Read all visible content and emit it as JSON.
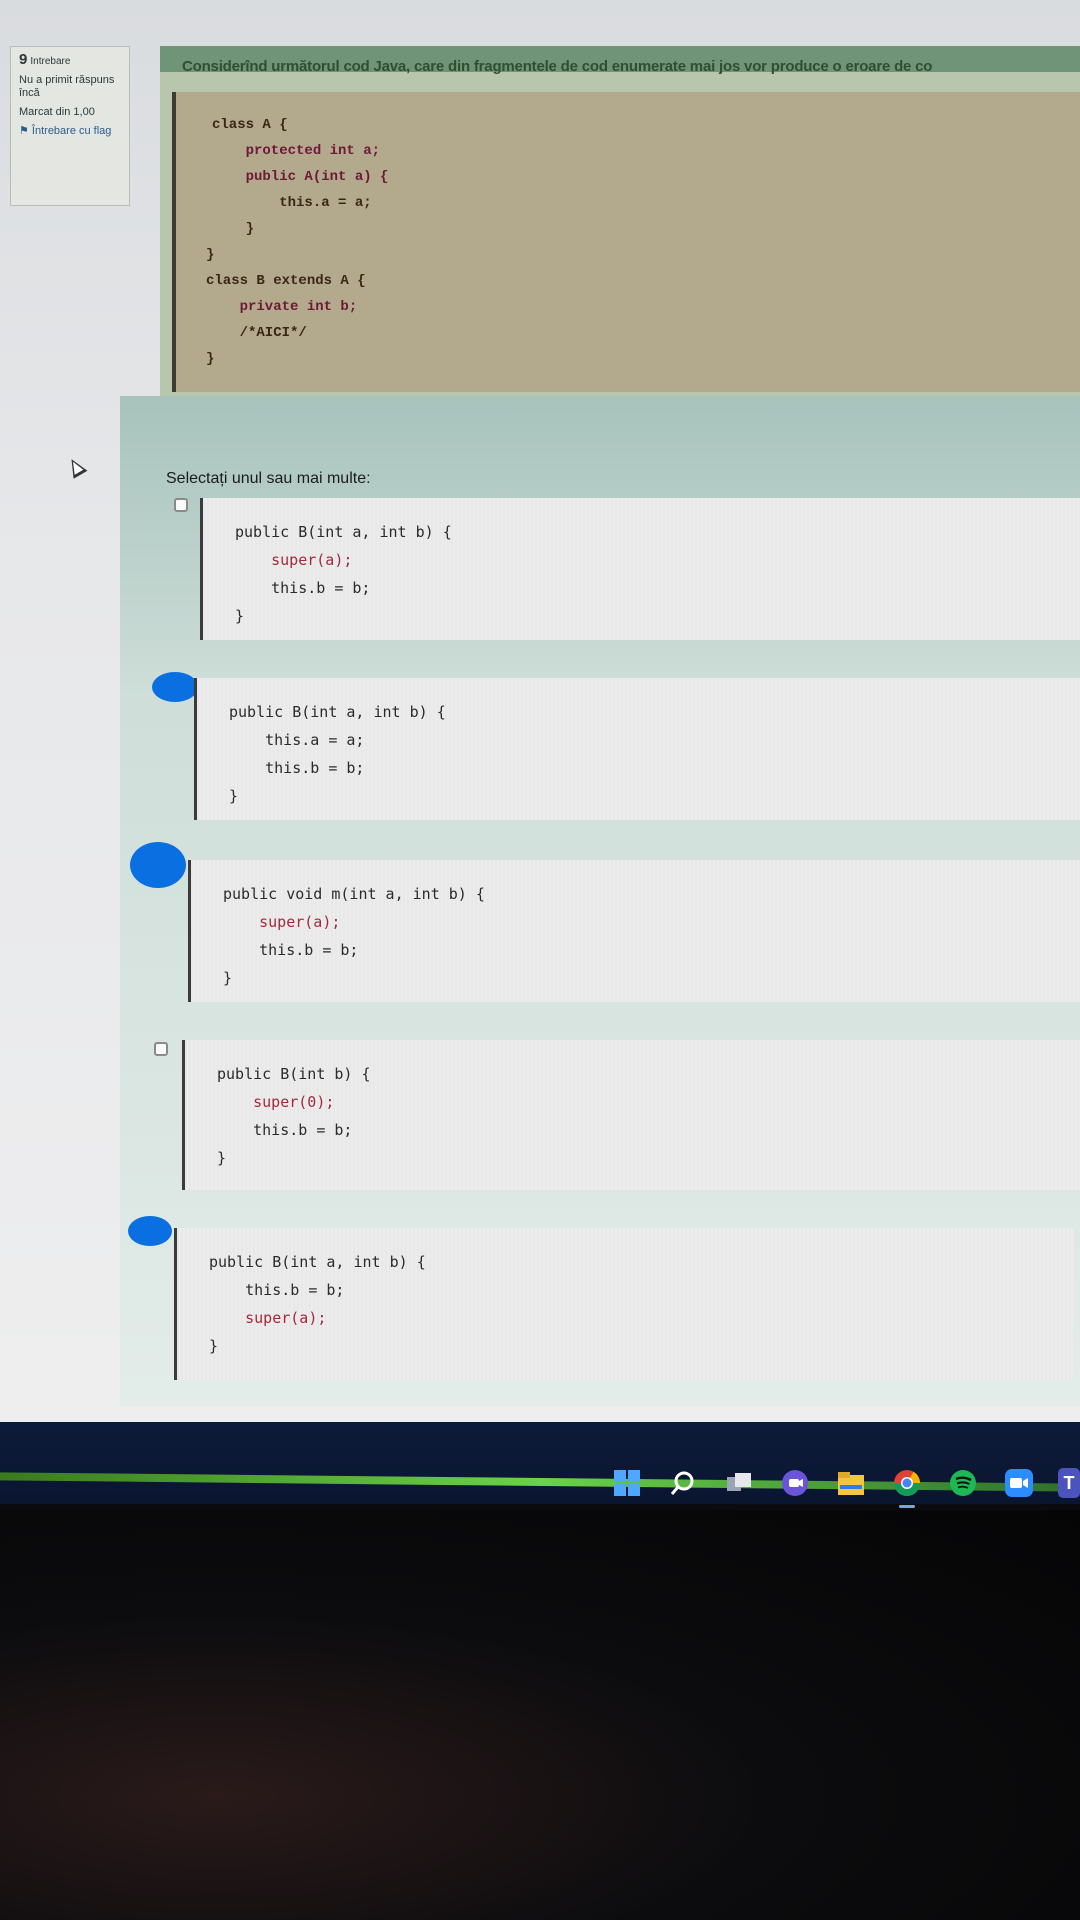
{
  "sidebar": {
    "question_number": "9",
    "question_word": "Intrebare",
    "status": "Nu a primit răspuns încă",
    "mark": "Marcat din 1,00",
    "flag_label": "Întrebare cu flag"
  },
  "question": {
    "title": "Considerînd următorul cod Java, care din fragmentele de cod enumerate mai jos vor produce o eroare de co",
    "code_lines": [
      "class A {",
      "    protected int a;",
      "    public A(int a) {",
      "        this.a = a;",
      "    }",
      "}",
      "class B extends A {",
      "    private int b;",
      "    /*AICI*/",
      "}"
    ]
  },
  "prompt": "Selectați unul sau mai multe:",
  "options": [
    {
      "lines": [
        "public B(int a, int b) {",
        "    super(a);",
        "    this.b = b;",
        "}"
      ],
      "marker": "checkbox"
    },
    {
      "lines": [
        "public B(int a, int b) {",
        "    this.a = a;",
        "    this.b = b;",
        "}"
      ],
      "marker": "blob"
    },
    {
      "lines": [
        "public void m(int a, int b) {",
        "    super(a);",
        "    this.b = b;",
        "}"
      ],
      "marker": "blob"
    },
    {
      "lines": [
        "public B(int b) {",
        "    super(0);",
        "    this.b = b;",
        "}"
      ],
      "marker": "checkbox"
    },
    {
      "lines": [
        "public B(int a, int b) {",
        "    this.b = b;",
        "    super(a);",
        "}"
      ],
      "marker": "blob"
    }
  ],
  "taskbar": {
    "icons": [
      "windows-start-icon",
      "search-icon",
      "task-view-icon",
      "chat-icon",
      "file-explorer-icon",
      "chrome-icon",
      "spotify-icon",
      "zoom-icon",
      "teams-icon"
    ],
    "teams_letter": "T"
  },
  "colors": {
    "header_green": "#6f9477",
    "code_bg": "#b3a98c",
    "answer_bg": "#ececec",
    "annotation_blue": "#0a6fe0",
    "taskbar": "#0d1b3a"
  }
}
